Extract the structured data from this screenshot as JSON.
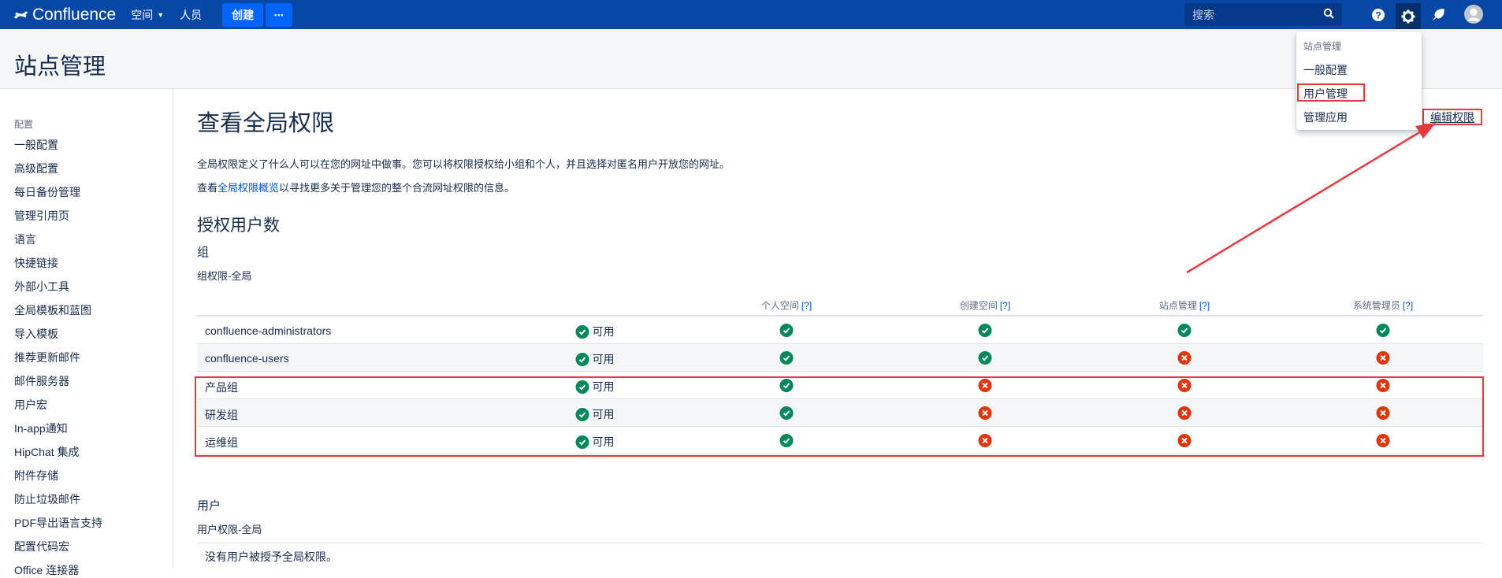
{
  "app": {
    "name": "Confluence"
  },
  "topnav": {
    "spaces": "空间",
    "people": "人员",
    "create": "创建",
    "more": "•••",
    "search_placeholder": "搜索"
  },
  "page": {
    "title": "站点管理"
  },
  "sidebar": {
    "section": "配置",
    "items": [
      "一般配置",
      "高级配置",
      "每日备份管理",
      "管理引用页",
      "语言",
      "快捷链接",
      "外部小工具",
      "全局模板和蓝图",
      "导入模板",
      "推荐更新邮件",
      "邮件服务器",
      "用户宏",
      "In-app通知",
      "HipChat 集成",
      "附件存储",
      "防止垃圾邮件",
      "PDF导出语言支持",
      "配置代码宏",
      "Office 连接器"
    ]
  },
  "main": {
    "title": "查看全局权限",
    "para1": "全局权限定义了什么人可以在您的网址中做事。您可以将权限授权给小组和个人，并且选择对匿名用户开放您的网址。",
    "para2_prefix": "查看",
    "para2_link": "全局权限概览",
    "para2_suffix": "以寻找更多关于管理您的整个合流网址权限的信息。",
    "licensed_heading": "授权用户数",
    "groups_heading": "组",
    "groups_sub": "组权限-全局",
    "users_heading": "用户",
    "users_sub": "用户权限-全局",
    "no_users": "没有用户被授予全局权限。"
  },
  "table": {
    "columns": [
      {
        "label": "个人空间",
        "help": "[?]"
      },
      {
        "label": "创建空间",
        "help": "[?]"
      },
      {
        "label": "站点管理",
        "help": "[?]"
      },
      {
        "label": "系统管理员",
        "help": "[?]"
      }
    ],
    "can_use_label": "可用",
    "rows": [
      {
        "name": "confluence-administrators",
        "personal": true,
        "create": true,
        "site_admin": true,
        "sys_admin": true
      },
      {
        "name": "confluence-users",
        "personal": true,
        "create": true,
        "site_admin": false,
        "sys_admin": false
      },
      {
        "name": "产品组",
        "personal": true,
        "create": false,
        "site_admin": false,
        "sys_admin": false
      },
      {
        "name": "研发组",
        "personal": true,
        "create": false,
        "site_admin": false,
        "sys_admin": false
      },
      {
        "name": "运维组",
        "personal": true,
        "create": false,
        "site_admin": false,
        "sys_admin": false
      }
    ]
  },
  "dropdown": {
    "header": "站点管理",
    "items": [
      "一般配置",
      "用户管理",
      "管理应用"
    ]
  },
  "edit_permissions": "编辑权限",
  "colors": {
    "nav": "#0747a6",
    "ok": "#00875a",
    "no": "#de350b",
    "annotation": "#e5393e"
  }
}
